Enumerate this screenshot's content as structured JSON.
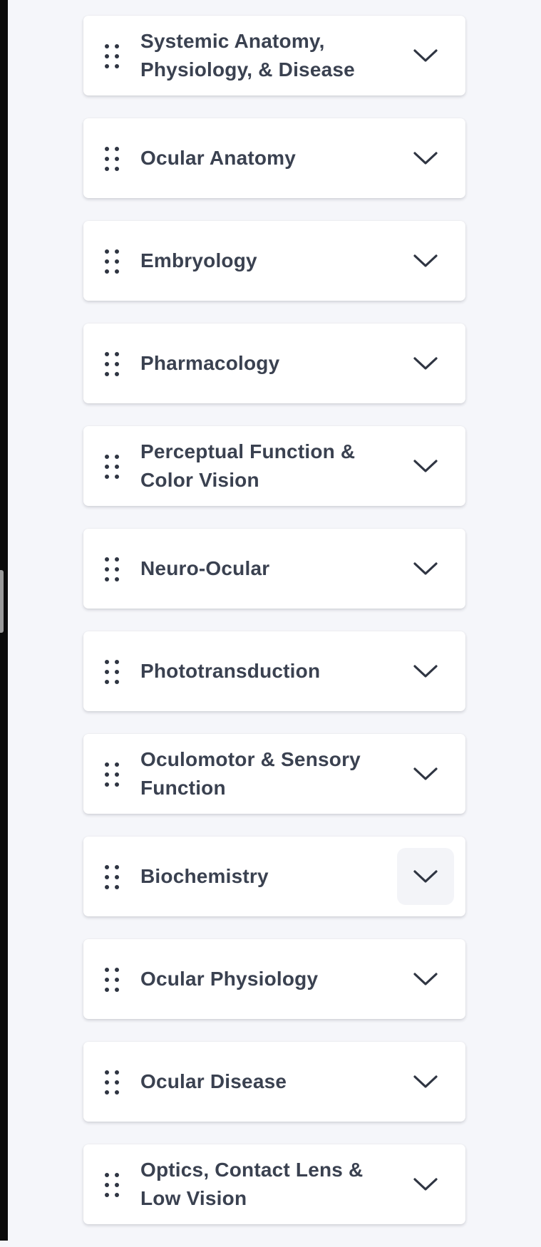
{
  "accordion": {
    "items": [
      {
        "label": "Systemic Anatomy, Physiology, & Disease",
        "icon": "chevron-down-icon",
        "handle_icon": "drag-handle-icon"
      },
      {
        "label": "Ocular Anatomy",
        "icon": "chevron-down-icon",
        "handle_icon": "drag-handle-icon"
      },
      {
        "label": "Embryology",
        "icon": "chevron-down-icon",
        "handle_icon": "drag-handle-icon"
      },
      {
        "label": "Pharmacology",
        "icon": "chevron-down-icon",
        "handle_icon": "drag-handle-icon"
      },
      {
        "label": "Perceptual Function & Color Vision",
        "icon": "chevron-down-icon",
        "handle_icon": "drag-handle-icon"
      },
      {
        "label": "Neuro-Ocular",
        "icon": "chevron-down-icon",
        "handle_icon": "drag-handle-icon"
      },
      {
        "label": "Phototransduction",
        "icon": "chevron-down-icon",
        "handle_icon": "drag-handle-icon"
      },
      {
        "label": "Oculomotor & Sensory Function",
        "icon": "chevron-down-icon",
        "handle_icon": "drag-handle-icon"
      },
      {
        "label": "Biochemistry",
        "icon": "chevron-down-icon",
        "handle_icon": "drag-handle-icon",
        "state": "hovered"
      },
      {
        "label": "Ocular Physiology",
        "icon": "chevron-down-icon",
        "handle_icon": "drag-handle-icon"
      },
      {
        "label": "Ocular Disease",
        "icon": "chevron-down-icon",
        "handle_icon": "drag-handle-icon"
      },
      {
        "label": "Optics, Contact Lens & Low Vision",
        "icon": "chevron-down-icon",
        "handle_icon": "drag-handle-icon"
      }
    ]
  },
  "colors": {
    "page_background": "#f5f6fa",
    "card_background": "#ffffff",
    "text": "#3a4150",
    "icon": "#2f3542",
    "hover_background": "#f3f4f8"
  }
}
